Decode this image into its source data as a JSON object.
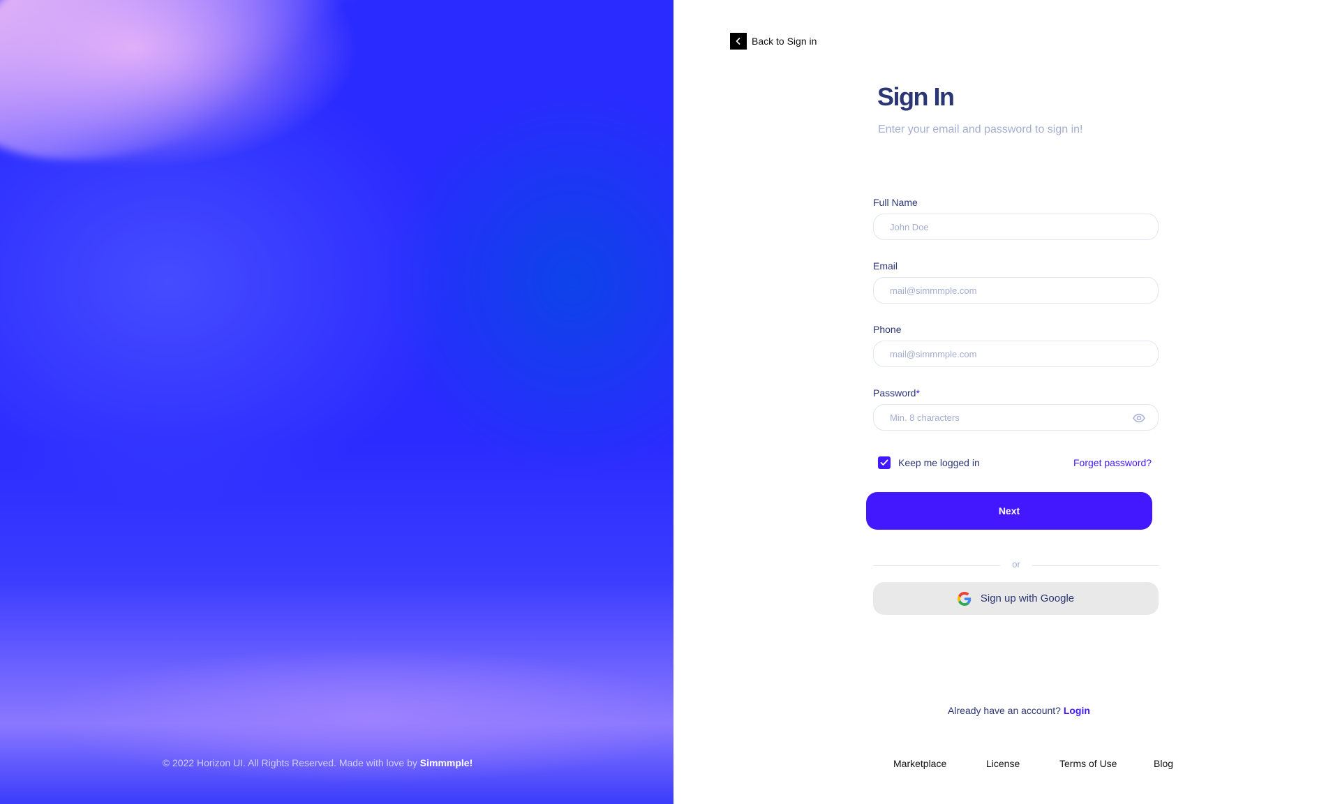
{
  "back_link": {
    "label": "Back to Sign in"
  },
  "header": {
    "title": "Sign In",
    "subtitle": "Enter your email and password to sign in!"
  },
  "form": {
    "full_name": {
      "label": "Full Name",
      "placeholder": "John Doe",
      "value": ""
    },
    "email": {
      "label": "Email",
      "placeholder": "mail@simmmple.com",
      "value": ""
    },
    "phone": {
      "label": "Phone",
      "placeholder": "mail@simmmple.com",
      "value": ""
    },
    "password": {
      "label": "Password",
      "required_mark": "*",
      "placeholder": "Min. 8 characters",
      "value": ""
    },
    "keep_logged_in": {
      "label": "Keep me logged in",
      "checked": true
    },
    "forgot_password": "Forget password?",
    "submit_label": "Next",
    "divider_text": "or",
    "google_label": "Sign up with Google"
  },
  "account_prompt": {
    "text": "Already have an account?",
    "link": "Login"
  },
  "hero_footer": {
    "text": "© 2022 Horizon UI. All Rights Reserved. Made with love by",
    "brand": "Simmmple!"
  },
  "footer_links": [
    "Marketplace",
    "License",
    "Terms of Use",
    "Blog"
  ],
  "colors": {
    "brand": "#4318ff",
    "navy": "#2b3674",
    "muted": "#a3aed0",
    "border": "#e0e5f2",
    "google_button_bg": "#e9e9e9"
  },
  "icons": {
    "back": "chevron-left-icon",
    "password_toggle": "eye-icon",
    "checkbox": "check-icon",
    "google": "google-logo-icon"
  }
}
